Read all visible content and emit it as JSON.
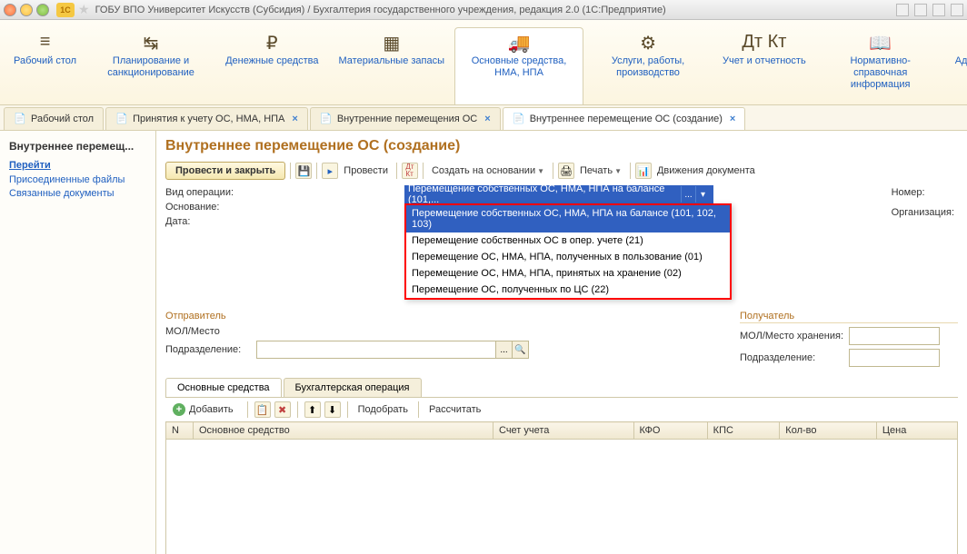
{
  "titlebar": {
    "title": "ГОБУ ВПО Университет Искусств (Субсидия) / Бухгалтерия государственного учреждения, редакция 2.0   (1С:Предприятие)"
  },
  "nav": [
    {
      "icon": "≡",
      "label": "Рабочий\nстол"
    },
    {
      "icon": "↹",
      "label": "Планирование и\nсанкционирование"
    },
    {
      "icon": "₽",
      "label": "Денежные\nсредства"
    },
    {
      "icon": "▦",
      "label": "Материальные\nзапасы"
    },
    {
      "icon": "🚚",
      "label": "Основные средства,\nНМА, НПА"
    },
    {
      "icon": "⚙",
      "label": "Услуги, работы,\nпроизводство"
    },
    {
      "icon": "Дт\nКт",
      "label": "Учет и\nотчетность"
    },
    {
      "icon": "📖",
      "label": "Нормативно-справочная\nинформация"
    },
    {
      "icon": "⚒",
      "label": "Администрирование"
    }
  ],
  "tabs": [
    {
      "label": "Рабочий стол",
      "closable": false
    },
    {
      "label": "Принятия к учету ОС, НМА, НПА",
      "closable": true
    },
    {
      "label": "Внутренние перемещения ОС",
      "closable": true
    },
    {
      "label": "Внутреннее перемещение ОС (создание)",
      "closable": true,
      "active": true
    }
  ],
  "sidebar": {
    "title": "Внутреннее перемещ...",
    "heading": "Перейти",
    "links": [
      "Присоединенные файлы",
      "Связанные документы"
    ]
  },
  "form": {
    "title": "Внутреннее перемещение ОС (создание)",
    "toolbar": {
      "submit": "Провести и закрыть",
      "provesti": "Провести",
      "create_based": "Создать на основании",
      "print": "Печать",
      "movements": "Движения документа"
    },
    "labels": {
      "vid": "Вид операции:",
      "osnovanie": "Основание:",
      "data": "Дата:",
      "nomer": "Номер:",
      "org": "Организация:",
      "otprav": "Отправитель",
      "poluch": "Получатель",
      "mol": "МОЛ/Место хранения:",
      "podrazd": "Подразделение:"
    },
    "vid_selected": "Перемещение собственных ОС, НМА, НПА на балансе (101,...",
    "dropdown": [
      {
        "text": "Перемещение собственных ОС, НМА, НПА на балансе (101, 102, 103)",
        "selected": true
      },
      {
        "text": "Перемещение собственных ОС в опер. учете (21)"
      },
      {
        "text": "Перемещение ОС, НМА, НПА, полученных в пользование (01)"
      },
      {
        "text": "Перемещение ОС, НМА, НПА, принятых на хранение (02)"
      },
      {
        "text": "Перемещение ОС, полученных по ЦС (22)"
      }
    ],
    "subtabs": [
      "Основные средства",
      "Бухгалтерская операция"
    ],
    "subtoolbar": {
      "add": "Добавить",
      "select": "Подобрать",
      "calc": "Рассчитать"
    },
    "columns": [
      "N",
      "Основное средство",
      "Счет учета",
      "КФО",
      "КПС",
      "Кол-во",
      "Цена"
    ]
  }
}
